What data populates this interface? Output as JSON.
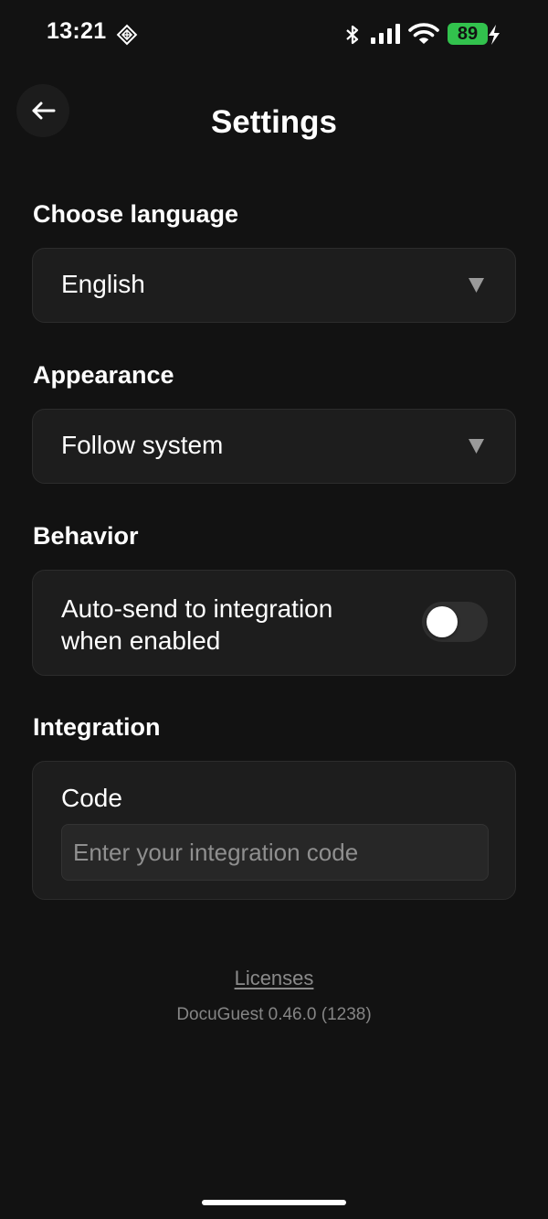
{
  "status_bar": {
    "time": "13:21",
    "battery_level": "89",
    "icons": [
      "focus-mode-icon",
      "bluetooth-icon",
      "cellular-signal-icon",
      "wifi-icon",
      "battery-icon",
      "charging-bolt-icon"
    ]
  },
  "header": {
    "title": "Settings",
    "back_icon": "arrow-left-icon"
  },
  "language": {
    "label": "Choose language",
    "selected": "English",
    "arrow_icon": "triangle-down-icon"
  },
  "appearance": {
    "label": "Appearance",
    "selected": "Follow system",
    "arrow_icon": "triangle-down-icon"
  },
  "behavior": {
    "label": "Behavior",
    "option_label": "Auto-send to integration when enabled",
    "toggle_on": false
  },
  "integration": {
    "label": "Integration",
    "code_label": "Code",
    "code_value": "",
    "code_placeholder": "Enter your integration code"
  },
  "footer": {
    "licenses_link": "Licenses",
    "version": "DocuGuest 0.46.0 (1238)"
  },
  "colors": {
    "background": "#121212",
    "card": "#1d1d1d",
    "battery": "#32c24d",
    "muted_text": "#8a8a8a"
  }
}
